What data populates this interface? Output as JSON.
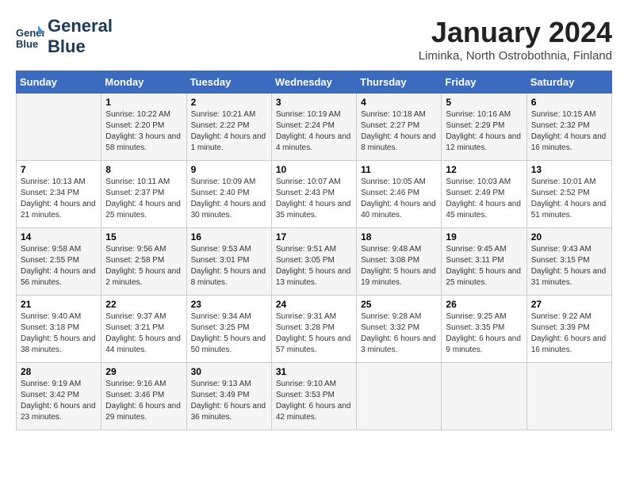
{
  "header": {
    "logo_line1": "General",
    "logo_line2": "Blue",
    "month": "January 2024",
    "location": "Liminka, North Ostrobothnia, Finland"
  },
  "weekdays": [
    "Sunday",
    "Monday",
    "Tuesday",
    "Wednesday",
    "Thursday",
    "Friday",
    "Saturday"
  ],
  "weeks": [
    [
      {
        "day": "",
        "sunrise": "",
        "sunset": "",
        "daylight": ""
      },
      {
        "day": "1",
        "sunrise": "Sunrise: 10:22 AM",
        "sunset": "Sunset: 2:20 PM",
        "daylight": "Daylight: 3 hours and 58 minutes."
      },
      {
        "day": "2",
        "sunrise": "Sunrise: 10:21 AM",
        "sunset": "Sunset: 2:22 PM",
        "daylight": "Daylight: 4 hours and 1 minute."
      },
      {
        "day": "3",
        "sunrise": "Sunrise: 10:19 AM",
        "sunset": "Sunset: 2:24 PM",
        "daylight": "Daylight: 4 hours and 4 minutes."
      },
      {
        "day": "4",
        "sunrise": "Sunrise: 10:18 AM",
        "sunset": "Sunset: 2:27 PM",
        "daylight": "Daylight: 4 hours and 8 minutes."
      },
      {
        "day": "5",
        "sunrise": "Sunrise: 10:16 AM",
        "sunset": "Sunset: 2:29 PM",
        "daylight": "Daylight: 4 hours and 12 minutes."
      },
      {
        "day": "6",
        "sunrise": "Sunrise: 10:15 AM",
        "sunset": "Sunset: 2:32 PM",
        "daylight": "Daylight: 4 hours and 16 minutes."
      }
    ],
    [
      {
        "day": "7",
        "sunrise": "Sunrise: 10:13 AM",
        "sunset": "Sunset: 2:34 PM",
        "daylight": "Daylight: 4 hours and 21 minutes."
      },
      {
        "day": "8",
        "sunrise": "Sunrise: 10:11 AM",
        "sunset": "Sunset: 2:37 PM",
        "daylight": "Daylight: 4 hours and 25 minutes."
      },
      {
        "day": "9",
        "sunrise": "Sunrise: 10:09 AM",
        "sunset": "Sunset: 2:40 PM",
        "daylight": "Daylight: 4 hours and 30 minutes."
      },
      {
        "day": "10",
        "sunrise": "Sunrise: 10:07 AM",
        "sunset": "Sunset: 2:43 PM",
        "daylight": "Daylight: 4 hours and 35 minutes."
      },
      {
        "day": "11",
        "sunrise": "Sunrise: 10:05 AM",
        "sunset": "Sunset: 2:46 PM",
        "daylight": "Daylight: 4 hours and 40 minutes."
      },
      {
        "day": "12",
        "sunrise": "Sunrise: 10:03 AM",
        "sunset": "Sunset: 2:49 PM",
        "daylight": "Daylight: 4 hours and 45 minutes."
      },
      {
        "day": "13",
        "sunrise": "Sunrise: 10:01 AM",
        "sunset": "Sunset: 2:52 PM",
        "daylight": "Daylight: 4 hours and 51 minutes."
      }
    ],
    [
      {
        "day": "14",
        "sunrise": "Sunrise: 9:58 AM",
        "sunset": "Sunset: 2:55 PM",
        "daylight": "Daylight: 4 hours and 56 minutes."
      },
      {
        "day": "15",
        "sunrise": "Sunrise: 9:56 AM",
        "sunset": "Sunset: 2:58 PM",
        "daylight": "Daylight: 5 hours and 2 minutes."
      },
      {
        "day": "16",
        "sunrise": "Sunrise: 9:53 AM",
        "sunset": "Sunset: 3:01 PM",
        "daylight": "Daylight: 5 hours and 8 minutes."
      },
      {
        "day": "17",
        "sunrise": "Sunrise: 9:51 AM",
        "sunset": "Sunset: 3:05 PM",
        "daylight": "Daylight: 5 hours and 13 minutes."
      },
      {
        "day": "18",
        "sunrise": "Sunrise: 9:48 AM",
        "sunset": "Sunset: 3:08 PM",
        "daylight": "Daylight: 5 hours and 19 minutes."
      },
      {
        "day": "19",
        "sunrise": "Sunrise: 9:45 AM",
        "sunset": "Sunset: 3:11 PM",
        "daylight": "Daylight: 5 hours and 25 minutes."
      },
      {
        "day": "20",
        "sunrise": "Sunrise: 9:43 AM",
        "sunset": "Sunset: 3:15 PM",
        "daylight": "Daylight: 5 hours and 31 minutes."
      }
    ],
    [
      {
        "day": "21",
        "sunrise": "Sunrise: 9:40 AM",
        "sunset": "Sunset: 3:18 PM",
        "daylight": "Daylight: 5 hours and 38 minutes."
      },
      {
        "day": "22",
        "sunrise": "Sunrise: 9:37 AM",
        "sunset": "Sunset: 3:21 PM",
        "daylight": "Daylight: 5 hours and 44 minutes."
      },
      {
        "day": "23",
        "sunrise": "Sunrise: 9:34 AM",
        "sunset": "Sunset: 3:25 PM",
        "daylight": "Daylight: 5 hours and 50 minutes."
      },
      {
        "day": "24",
        "sunrise": "Sunrise: 9:31 AM",
        "sunset": "Sunset: 3:28 PM",
        "daylight": "Daylight: 5 hours and 57 minutes."
      },
      {
        "day": "25",
        "sunrise": "Sunrise: 9:28 AM",
        "sunset": "Sunset: 3:32 PM",
        "daylight": "Daylight: 6 hours and 3 minutes."
      },
      {
        "day": "26",
        "sunrise": "Sunrise: 9:25 AM",
        "sunset": "Sunset: 3:35 PM",
        "daylight": "Daylight: 6 hours and 9 minutes."
      },
      {
        "day": "27",
        "sunrise": "Sunrise: 9:22 AM",
        "sunset": "Sunset: 3:39 PM",
        "daylight": "Daylight: 6 hours and 16 minutes."
      }
    ],
    [
      {
        "day": "28",
        "sunrise": "Sunrise: 9:19 AM",
        "sunset": "Sunset: 3:42 PM",
        "daylight": "Daylight: 6 hours and 23 minutes."
      },
      {
        "day": "29",
        "sunrise": "Sunrise: 9:16 AM",
        "sunset": "Sunset: 3:46 PM",
        "daylight": "Daylight: 6 hours and 29 minutes."
      },
      {
        "day": "30",
        "sunrise": "Sunrise: 9:13 AM",
        "sunset": "Sunset: 3:49 PM",
        "daylight": "Daylight: 6 hours and 36 minutes."
      },
      {
        "day": "31",
        "sunrise": "Sunrise: 9:10 AM",
        "sunset": "Sunset: 3:53 PM",
        "daylight": "Daylight: 6 hours and 42 minutes."
      },
      {
        "day": "",
        "sunrise": "",
        "sunset": "",
        "daylight": ""
      },
      {
        "day": "",
        "sunrise": "",
        "sunset": "",
        "daylight": ""
      },
      {
        "day": "",
        "sunrise": "",
        "sunset": "",
        "daylight": ""
      }
    ]
  ]
}
